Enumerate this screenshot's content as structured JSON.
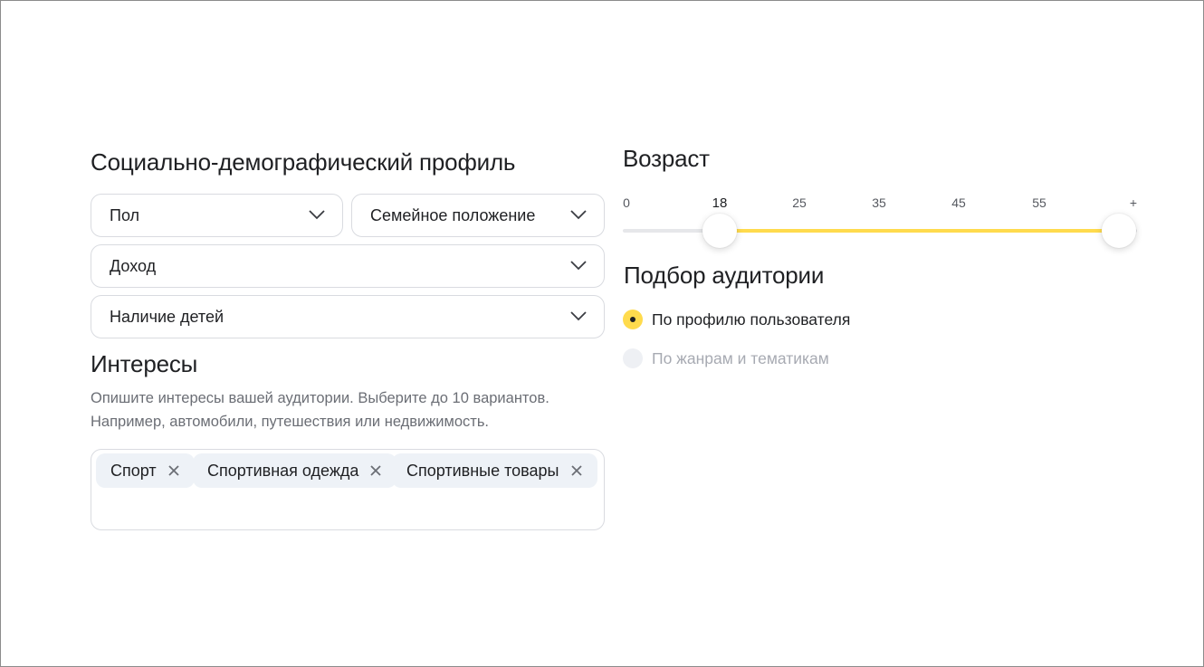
{
  "profile": {
    "title": "Социально-демографический профиль",
    "gender": "Пол",
    "marital": "Семейное положение",
    "income": "Доход",
    "children": "Наличие детей"
  },
  "interests": {
    "title": "Интересы",
    "hint_line1": "Опишите интересы вашей аудитории. Выберите до 10 вариантов.",
    "hint_line2": "Например, автомобили, путешествия или недвижимость.",
    "tags": [
      "Спорт",
      "Спортивная одежда",
      "Спортивные товары"
    ]
  },
  "age": {
    "title": "Возраст",
    "ticks": [
      "0",
      "18",
      "25",
      "35",
      "45",
      "55",
      "+"
    ],
    "selected_min": "18",
    "selected_max": "+"
  },
  "audience": {
    "title": "Подбор аудитории",
    "options": [
      {
        "label": "По профилю пользователя",
        "selected": true
      },
      {
        "label": "По жанрам и тематикам",
        "selected": false
      }
    ]
  },
  "colors": {
    "accent": "#ffdb4d",
    "border": "#d9dbe0",
    "tag_bg": "#eef2f7",
    "muted_text": "#6b6e75"
  }
}
